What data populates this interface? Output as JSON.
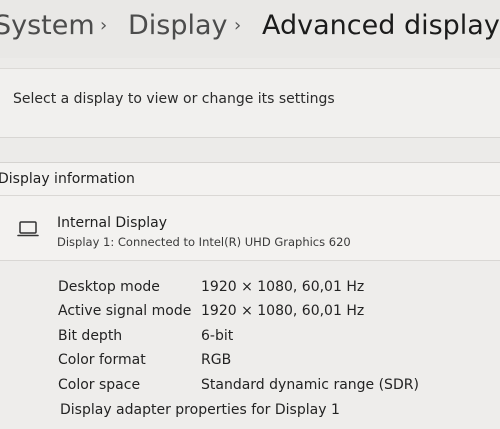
{
  "breadcrumb": {
    "items": [
      "System",
      "Display",
      "Advanced display"
    ],
    "separator": "›"
  },
  "select_display": {
    "label": "Select a display to view or change its settings"
  },
  "display_information": {
    "title": "Display information",
    "display": {
      "icon": "laptop-icon",
      "name": "Internal Display",
      "connection": "Display 1: Connected to Intel(R) UHD Graphics 620"
    },
    "properties": [
      {
        "label": "Desktop mode",
        "value": "1920 × 1080, 60,01 Hz"
      },
      {
        "label": "Active signal mode",
        "value": "1920 × 1080, 60,01 Hz"
      },
      {
        "label": "Bit depth",
        "value": "6-bit"
      },
      {
        "label": "Color format",
        "value": "RGB"
      },
      {
        "label": "Color space",
        "value": "Standard dynamic range (SDR)"
      }
    ],
    "adapter_link": "Display adapter properties for Display 1"
  }
}
